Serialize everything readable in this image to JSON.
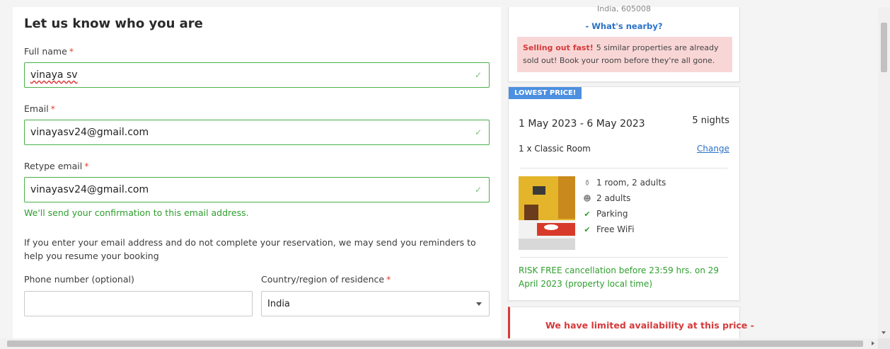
{
  "form": {
    "title": "Let us know who you are",
    "full_name_label": "Full name",
    "full_name_value": "vinaya sv",
    "email_label": "Email",
    "email_value": "vinayasv24@gmail.com",
    "retype_email_label": "Retype email",
    "retype_email_value": "vinayasv24@gmail.com",
    "required_mark": "*",
    "check_mark": "✓",
    "confirmation_message": "We'll send your confirmation to this email address.",
    "reminder_text": "If you enter your email address and do not complete your reservation, we may send you reminders to help you resume your booking",
    "phone_label": "Phone number (optional)",
    "phone_value": "",
    "country_label": "Country/region of residence",
    "country_value": "India"
  },
  "property_card": {
    "address": "India, 605008",
    "nearby_link": "- What's nearby?",
    "alert_strong": "Selling out fast!",
    "alert_text": "5 similar properties are already sold out! Book your room before they're all gone."
  },
  "booking": {
    "badge": "LOWEST PRICE!",
    "dates": "1 May 2023 - 6 May 2023",
    "nights": "5 nights",
    "room_type": "1 x Classic Room",
    "change_link": "Change",
    "amenities": [
      {
        "label": "1 room, 2 adults",
        "icon": "room-icon"
      },
      {
        "label": "2 adults",
        "icon": "adults-icon"
      },
      {
        "label": "Parking",
        "icon": "check-icon"
      },
      {
        "label": "Free WiFi",
        "icon": "check-icon"
      }
    ],
    "risk_free": "RISK FREE cancellation before 23:59 hrs. on 29 April 2023 (property local time)"
  },
  "availability": {
    "message": "We have limited availability at this price -"
  },
  "colors": {
    "accent_blue": "#2a72c7",
    "success_green": "#2e9e2e",
    "alert_red": "#d63a3a",
    "badge_blue": "#4d8fe0"
  }
}
